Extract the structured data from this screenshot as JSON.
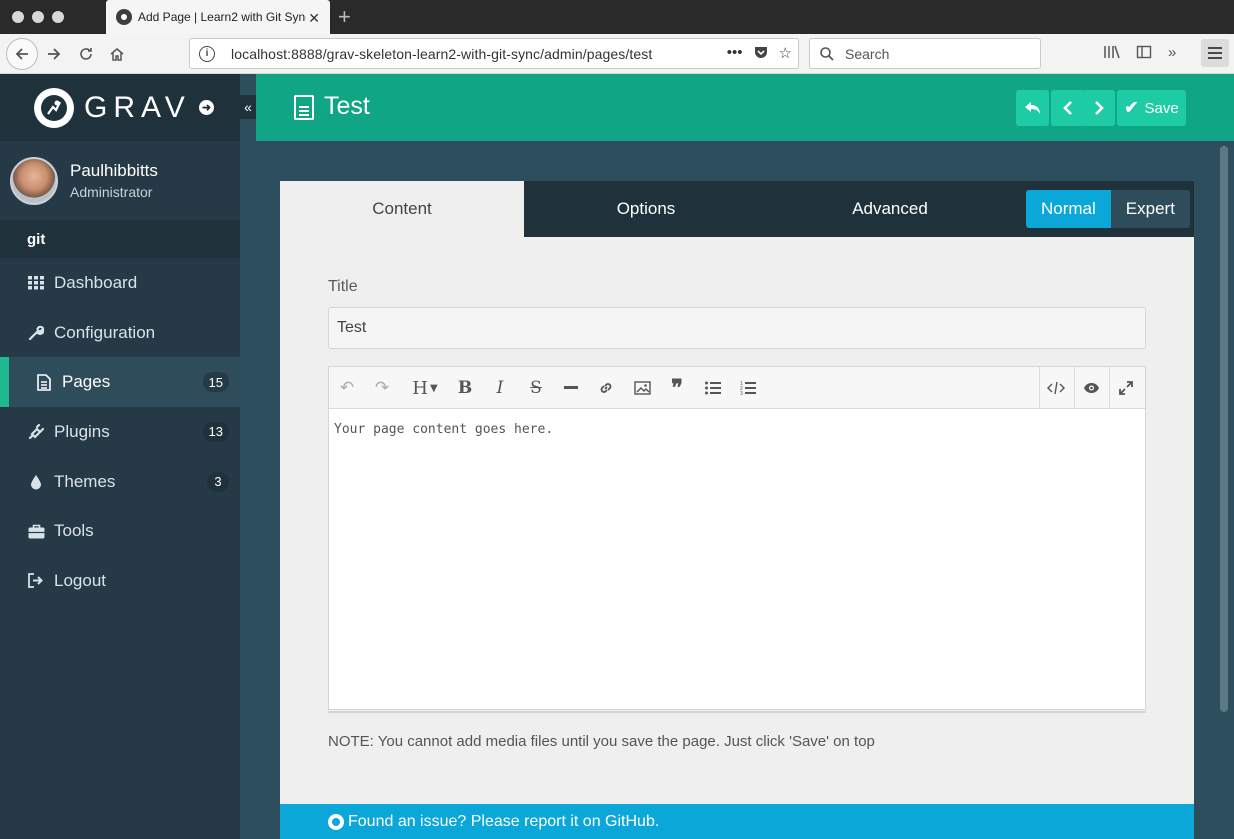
{
  "browser": {
    "tab_title": "Add Page | Learn2 with Git Sync",
    "url": "localhost:8888/grav-skeleton-learn2-with-git-sync/admin/pages/test",
    "search_placeholder": "Search"
  },
  "sidebar": {
    "logo_text": "GRAV",
    "user": {
      "name": "Paulhibbitts",
      "role": "Administrator"
    },
    "section_label": "git",
    "items": [
      {
        "label": "Dashboard",
        "icon": "grid-icon"
      },
      {
        "label": "Configuration",
        "icon": "wrench-icon"
      },
      {
        "label": "Pages",
        "icon": "file-icon",
        "badge": "15",
        "active": true
      },
      {
        "label": "Plugins",
        "icon": "plug-icon",
        "badge": "13"
      },
      {
        "label": "Themes",
        "icon": "tint-icon",
        "badge": "3"
      },
      {
        "label": "Tools",
        "icon": "briefcase-icon"
      },
      {
        "label": "Logout",
        "icon": "sign-out-icon"
      }
    ]
  },
  "header": {
    "title": "Test",
    "save_label": "Save"
  },
  "content": {
    "tabs": [
      "Content",
      "Options",
      "Advanced"
    ],
    "active_tab": "Content",
    "modes": [
      "Normal",
      "Expert"
    ],
    "active_mode": "Normal",
    "title_label": "Title",
    "title_value": "Test",
    "editor_text": "Your page content goes here.",
    "note": "NOTE: You cannot add media files until you save the page. Just click 'Save' on top",
    "footer": "Found an issue? Please report it on GitHub."
  },
  "colors": {
    "header_teal": "#10a585",
    "button_teal": "#1dcca4",
    "sidebar_dark": "#253a46",
    "accent_blue": "#0aa7d8"
  }
}
